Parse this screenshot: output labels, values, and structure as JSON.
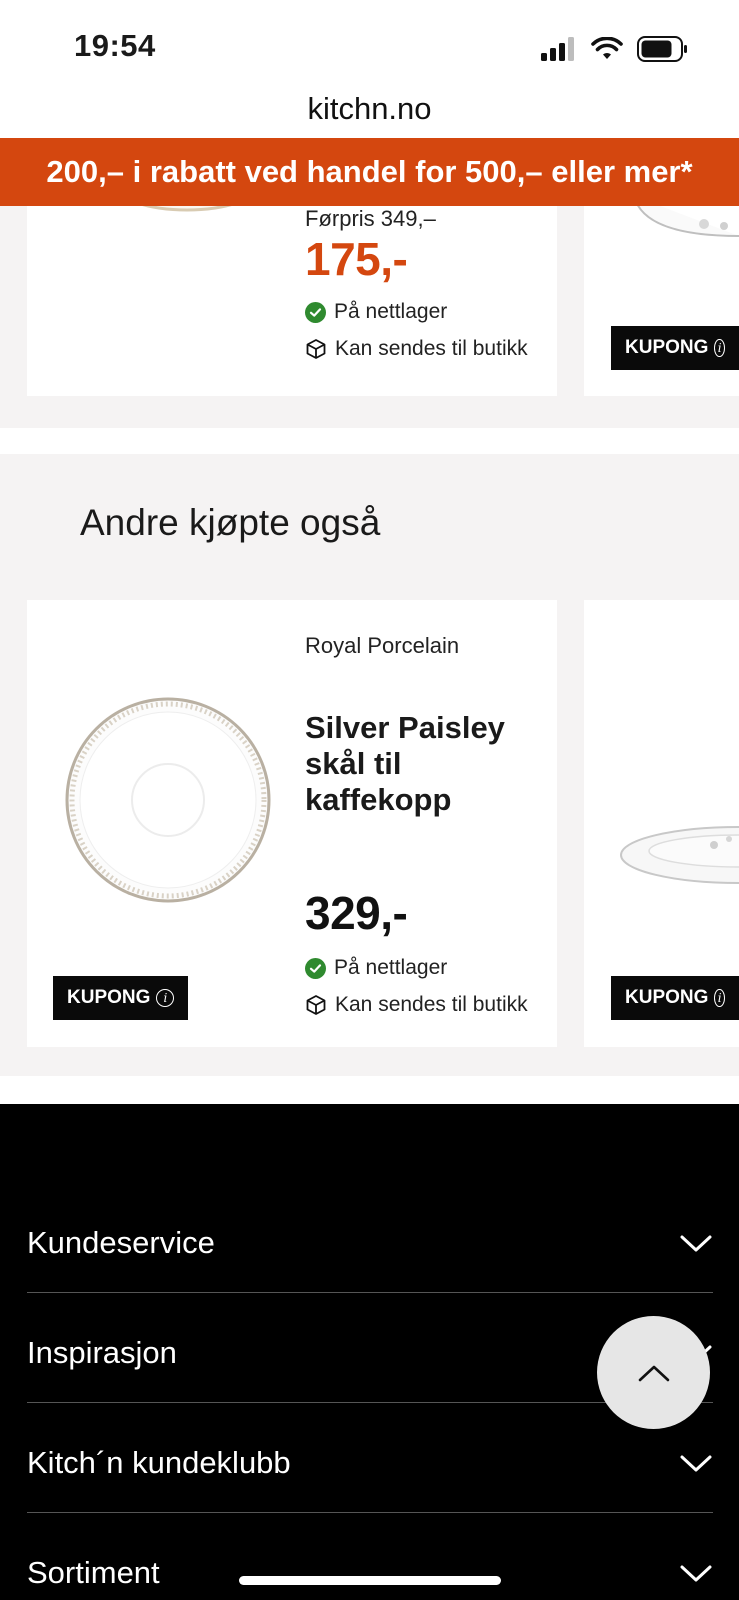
{
  "status_bar": {
    "time": "19:54"
  },
  "url_bar": {
    "domain": "kitchn.no"
  },
  "promo_banner": {
    "text": "200,– i rabatt ved handel for 500,– eller mer*"
  },
  "top_product": {
    "old_price": "Førpris 349,–",
    "price": "175,-",
    "stock": "På nettlager",
    "shipping": "Kan sendes til butikk",
    "coupon_right": "KUPONG"
  },
  "also_bought": {
    "title": "Andre kjøpte også",
    "products": [
      {
        "brand": "Royal Porcelain",
        "name": "Silver Paisley skål til kaffekopp",
        "price": "329,-",
        "stock": "På nettlager",
        "shipping": "Kan sendes til butikk",
        "coupon": "KUPONG"
      }
    ],
    "coupon_right": "KUPONG"
  },
  "footer": {
    "items": [
      {
        "label": "Kundeservice"
      },
      {
        "label": "Inspirasjon"
      },
      {
        "label": "Kitch´n kundeklubb"
      },
      {
        "label": "Sortiment"
      }
    ]
  },
  "colors": {
    "accent": "#d4470f",
    "stock_green": "#2f8a2f",
    "footer_bg": "#000000"
  }
}
